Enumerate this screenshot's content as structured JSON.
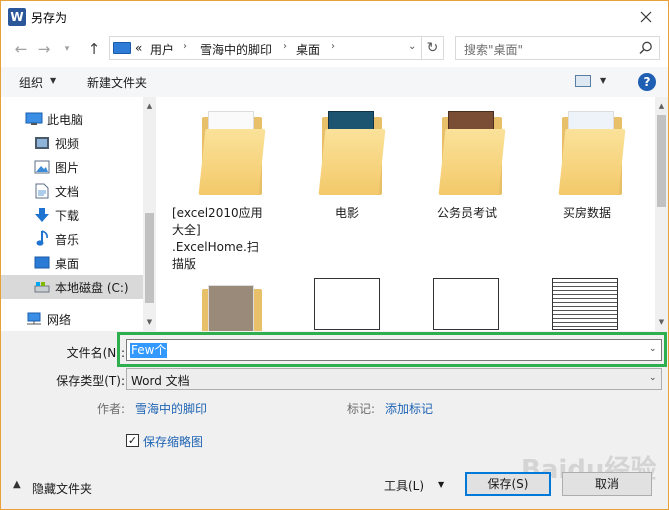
{
  "window": {
    "title": "另存为",
    "app_icon": "W"
  },
  "nav": {
    "address_parts": [
      "用户",
      "雪海中的脚印",
      "桌面"
    ],
    "address_prefix": "«",
    "search_placeholder": "搜索\"桌面\""
  },
  "toolbar": {
    "organize": "组织",
    "new_folder": "新建文件夹"
  },
  "sidebar": {
    "items": [
      {
        "label": "此电脑",
        "icon": "computer-icon"
      },
      {
        "label": "视频",
        "icon": "video-icon"
      },
      {
        "label": "图片",
        "icon": "picture-icon"
      },
      {
        "label": "文档",
        "icon": "document-icon"
      },
      {
        "label": "下载",
        "icon": "download-icon"
      },
      {
        "label": "音乐",
        "icon": "music-icon"
      },
      {
        "label": "桌面",
        "icon": "desktop-icon"
      },
      {
        "label": "本地磁盘 (C:)",
        "icon": "drive-icon"
      },
      {
        "label": "网络",
        "icon": "network-icon"
      }
    ]
  },
  "files": {
    "folders": [
      {
        "name_lines": [
          "[excel2010应用",
          "大全]",
          ".ExcelHome.扫",
          "描版"
        ]
      },
      {
        "name_lines": [
          "电影"
        ]
      },
      {
        "name_lines": [
          "公务员考试"
        ]
      },
      {
        "name_lines": [
          "买房数据"
        ]
      }
    ]
  },
  "form": {
    "filename_label": "文件名(N):",
    "filename_value": "Few个",
    "filetype_label": "保存类型(T):",
    "filetype_value": "Word 文档",
    "author_label": "作者:",
    "author_value": "雪海中的脚印",
    "tags_label": "标记:",
    "tags_value": "添加标记",
    "thumbnail_label": "保存缩略图",
    "thumbnail_checked": "✓"
  },
  "footer": {
    "hide_folders": "隐藏文件夹",
    "tools": "工具(L)",
    "save": "保存(S)",
    "cancel": "取消"
  },
  "watermark": "Baidu经验"
}
